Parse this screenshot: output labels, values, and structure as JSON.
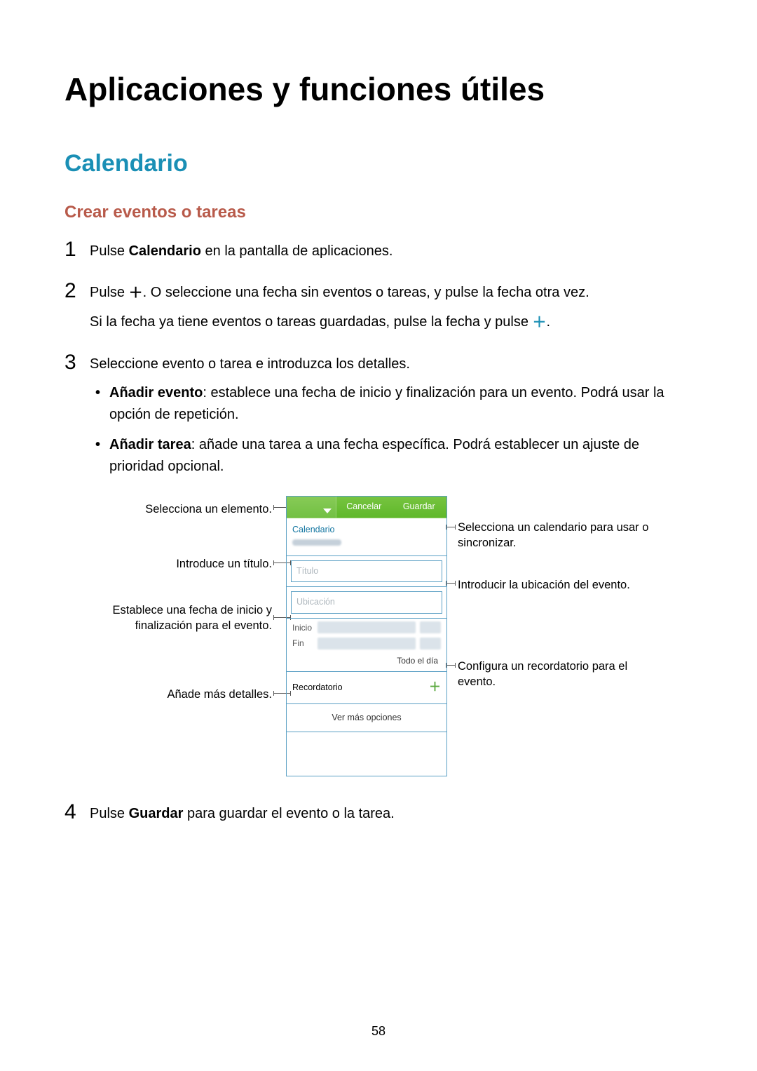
{
  "page_number": "58",
  "title": "Aplicaciones y funciones útiles",
  "section": "Calendario",
  "subsection": "Crear eventos o tareas",
  "steps": {
    "s1": {
      "num": "1",
      "pre": "Pulse ",
      "bold": "Calendario",
      "post": " en la pantalla de aplicaciones."
    },
    "s2": {
      "num": "2",
      "line1a": "Pulse ",
      "plus1": "＋",
      "line1b": ". O seleccione una fecha sin eventos o tareas, y pulse la fecha otra vez.",
      "line2a": "Si la fecha ya tiene eventos o tareas guardadas, pulse la fecha y pulse ",
      "plus2": "＋",
      "line2b": "."
    },
    "s3": {
      "num": "3",
      "intro": "Seleccione evento o tarea e introduzca los detalles.",
      "b1_bold": "Añadir evento",
      "b1_rest": ": establece una fecha de inicio y finalización para un evento. Podrá usar la opción de repetición.",
      "b2_bold": "Añadir tarea",
      "b2_rest": ": añade una tarea a una fecha específica. Podrá establecer un ajuste de prioridad opcional."
    },
    "s4": {
      "num": "4",
      "pre": "Pulse ",
      "bold": "Guardar",
      "post": " para guardar el evento o la tarea."
    }
  },
  "callouts": {
    "l1": "Selecciona un elemento.",
    "l2": "Introduce un título.",
    "l3": "Establece una fecha de inicio y finalización para el evento.",
    "l4": "Añade más detalles.",
    "r1": "Selecciona un calendario para usar o sincronizar.",
    "r2": "Introducir la ubicación del evento.",
    "r3": "Configura un recordatorio para el evento."
  },
  "mock": {
    "cancel": "Cancelar",
    "save": "Guardar",
    "calendar": "Calendario",
    "title_ph": "Título",
    "location_ph": "Ubicación",
    "start": "Inicio",
    "end": "Fin",
    "allday": "Todo el día",
    "reminder": "Recordatorio",
    "more": "Ver más opciones"
  }
}
